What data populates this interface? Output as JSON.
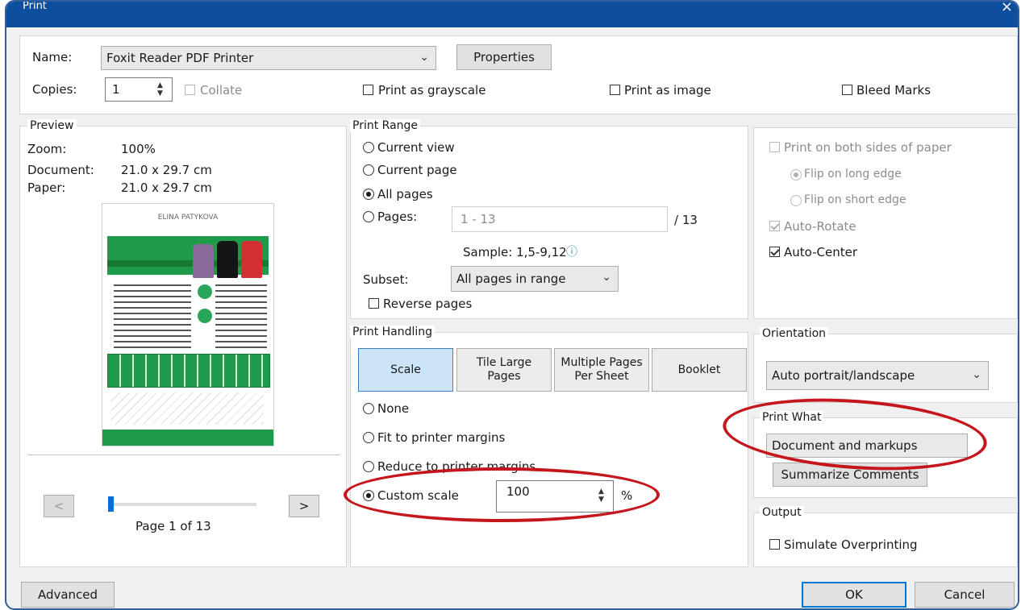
{
  "window": {
    "title": "Print",
    "close": "×"
  },
  "printer": {
    "name_label": "Name:",
    "name_value": "Foxit Reader PDF Printer",
    "properties_label": "Properties",
    "copies_label": "Copies:",
    "copies_value": "1",
    "collate_label": "Collate",
    "grayscale_label": "Print as grayscale",
    "image_label": "Print as image",
    "bleed_label": "Bleed Marks"
  },
  "preview": {
    "legend": "Preview",
    "zoom_label": "Zoom:",
    "zoom_value": "100%",
    "document_label": "Document:",
    "document_value": "21.0 x 29.7 cm",
    "paper_label": "Paper:",
    "paper_value": "21.0 x 29.7 cm",
    "thumb_brand": "ELINA PATYKOVA",
    "prev_button": "<",
    "next_button": ">",
    "page_indicator": "Page 1 of 13",
    "page_position": 0.0769
  },
  "print_range": {
    "legend": "Print Range",
    "current_view": "Current view",
    "current_page": "Current page",
    "all_pages": "All pages",
    "pages": "Pages:",
    "pages_value": "1 - 13",
    "pages_total": "/ 13",
    "sample": "Sample: 1,5-9,12",
    "subset_label": "Subset:",
    "subset_value": "All pages in range",
    "reverse_label": "Reverse pages"
  },
  "print_handling": {
    "legend": "Print Handling",
    "tabs": [
      "Scale",
      "Tile Large Pages",
      "Multiple Pages Per Sheet",
      "Booklet"
    ],
    "none": "None",
    "fit": "Fit to printer margins",
    "reduce": "Reduce to printer margins",
    "custom": "Custom scale",
    "custom_value": "100",
    "percent": "%"
  },
  "duplex": {
    "both_sides": "Print on both sides of paper",
    "flip_long": "Flip on long edge",
    "flip_short": "Flip on short edge",
    "auto_rotate": "Auto-Rotate",
    "auto_center": "Auto-Center"
  },
  "orientation": {
    "legend": "Orientation",
    "value": "Auto portrait/landscape"
  },
  "print_what": {
    "legend": "Print What",
    "value": "Document and markups",
    "summarize": "Summarize Comments"
  },
  "output": {
    "legend": "Output",
    "simulate": "Simulate Overprinting"
  },
  "footer": {
    "advanced": "Advanced",
    "ok": "OK",
    "cancel": "Cancel"
  },
  "colors": {
    "titlebar": "#0d4f9c",
    "annotation": "#c4161c",
    "selected_tab": "#cce4f7"
  }
}
